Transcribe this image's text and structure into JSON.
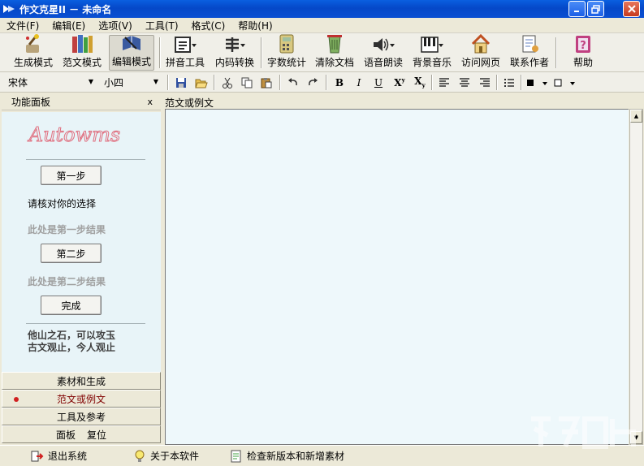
{
  "window": {
    "title": "作文克星II － 未命名"
  },
  "menu": [
    "文件(F)",
    "编辑(E)",
    "选项(V)",
    "工具(T)",
    "格式(C)",
    "帮助(H)"
  ],
  "toolbar": [
    {
      "label": "生成模式",
      "icon": "magic-wand-icon"
    },
    {
      "label": "范文模式",
      "icon": "books-icon"
    },
    {
      "label": "编辑模式",
      "icon": "edit-book-icon"
    },
    {
      "label": "拼音工具",
      "icon": "pinyin-icon"
    },
    {
      "label": "内码转换",
      "icon": "encoding-icon"
    },
    {
      "label": "字数统计",
      "icon": "calculator-icon"
    },
    {
      "label": "清除文档",
      "icon": "clear-doc-icon"
    },
    {
      "label": "语音朗读",
      "icon": "speaker-icon"
    },
    {
      "label": "背景音乐",
      "icon": "piano-icon"
    },
    {
      "label": "访问网页",
      "icon": "home-icon"
    },
    {
      "label": "联系作者",
      "icon": "contact-icon"
    },
    {
      "label": "帮助",
      "icon": "help-icon"
    }
  ],
  "format": {
    "font": "宋体",
    "size": "小四"
  },
  "panel": {
    "title": "功能面板",
    "close": "x",
    "logo": "Autowms",
    "step1": "第一步",
    "prompt": "请核对你的选择",
    "result1": "此处是第一步结果",
    "step2": "第二步",
    "result2": "此处是第二步结果",
    "done": "完成",
    "quote1": "他山之石，可以攻玉",
    "quote2": "古文观止，今人观止"
  },
  "nav": {
    "materials": "素材和生成",
    "essays": "范文或例文",
    "tools": "工具及参考",
    "panel": "面板",
    "reset": "复位"
  },
  "editor": {
    "title": "范文或例文"
  },
  "status": {
    "exit": "退出系统",
    "about": "关于本软件",
    "update": "检查新版本和新增素材"
  },
  "colors": {
    "titlebar": "#0548c8",
    "editor_bg": "#eef8fb",
    "selected_nav": "#800000"
  }
}
